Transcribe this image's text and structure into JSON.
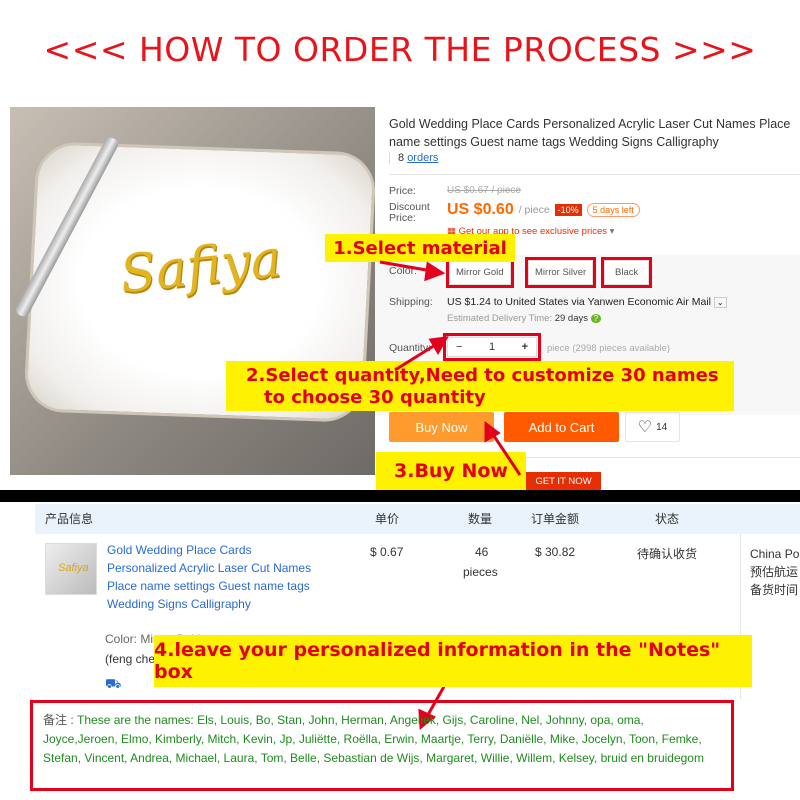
{
  "banner": {
    "title": "<<< HOW TO ORDER THE PROCESS >>>"
  },
  "photo": {
    "name_art": "Safiya"
  },
  "product": {
    "title": "Gold Wedding Place Cards Personalized Acrylic Laser Cut Names Place name settings Guest name tags Wedding Signs Calligraphy",
    "orders_count": "8",
    "orders_label": "orders",
    "price_label": "Price:",
    "original_price": "US $0.67 / piece",
    "discount_label": "Discount Price:",
    "discount_price": "US $0.60",
    "unit": "/ piece",
    "discount_badge": "-10%",
    "days_left": "5 days left",
    "app_promo": "Get our app to see exclusive prices",
    "color_label": "Color:",
    "colors": [
      "Mirror Gold",
      "Mirror Silver",
      "Black"
    ],
    "shipping_label": "Shipping:",
    "shipping": "US $1.24 to United States via Yanwen Economic Air Mail",
    "delivery_label": "Estimated Delivery Time:",
    "delivery_value": "29 days",
    "quantity_label": "Quantity:",
    "quantity": "1",
    "minus": "−",
    "plus": "+",
    "available": "piece (2998 pieces available)",
    "buy_now": "Buy Now",
    "add_to_cart": "Add to Cart",
    "wishlist_count": "14",
    "get_it_now": "GET IT NOW"
  },
  "callouts": {
    "step1": "1.Select material",
    "step2_line1": "2.Select quantity,Need to customize 30 names",
    "step2_line2": "to choose 30 quantity",
    "step3": "3.Buy Now",
    "step4": "4.leave your personalized information in the \"Notes\" box"
  },
  "order": {
    "headers": [
      "产品信息",
      "单价",
      "数量",
      "订单金额",
      "状态"
    ],
    "item_title": "Gold Wedding Place Cards Personalized Acrylic Laser Cut Names Place name settings Guest name tags Wedding Signs Calligraphy",
    "color": "Color: Mirror Gold",
    "seller": "(feng che",
    "unit_price": "$ 0.67",
    "quantity": "46",
    "quantity_unit": "pieces",
    "amount": "$ 30.82",
    "status": "待确认收货",
    "shipping_lines": [
      "China Po",
      "预估航运",
      "备货时间"
    ],
    "notes_label": "备注 :",
    "notes": "These are the names: Els, Louis, Bo, Stan, John, Herman, Angeliek, Gijs, Caroline, Nel, Johnny, opa, oma, Joyce,Jeroen, Elmo, Kimberly, Mitch, Kevin, Jp, Juliëtte, Roëlla, Erwin, Maartje, Terry, Daniëlle, Mike, Jocelyn, Toon, Femke, Stefan, Vincent, Andrea, Michael, Laura, Tom, Belle, Sebastian de Wijs, Margaret, Willie, Willem, Kelsey, bruid en bruidegom"
  },
  "colors": {
    "accent_red": "#e3001b",
    "callout_yellow": "#fff200",
    "buy_now": "#ff9a2e",
    "add_to_cart": "#ff5a00",
    "link_blue": "#2a6bd1",
    "notes_green": "#1e8c1e"
  }
}
